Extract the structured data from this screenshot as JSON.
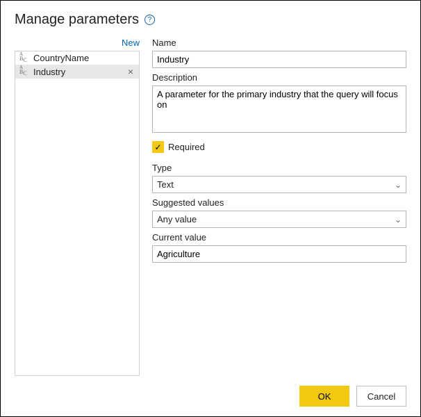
{
  "title": "Manage parameters",
  "newButton": "New",
  "parameters": [
    {
      "name": "CountryName",
      "selected": false
    },
    {
      "name": "Industry",
      "selected": true
    }
  ],
  "form": {
    "nameLabel": "Name",
    "nameValue": "Industry",
    "descriptionLabel": "Description",
    "descriptionValue": "A parameter for the primary industry that the query will focus on",
    "requiredLabel": "Required",
    "requiredChecked": true,
    "typeLabel": "Type",
    "typeValue": "Text",
    "suggestedLabel": "Suggested values",
    "suggestedValue": "Any value",
    "currentLabel": "Current value",
    "currentValue": "Agriculture"
  },
  "buttons": {
    "ok": "OK",
    "cancel": "Cancel"
  }
}
